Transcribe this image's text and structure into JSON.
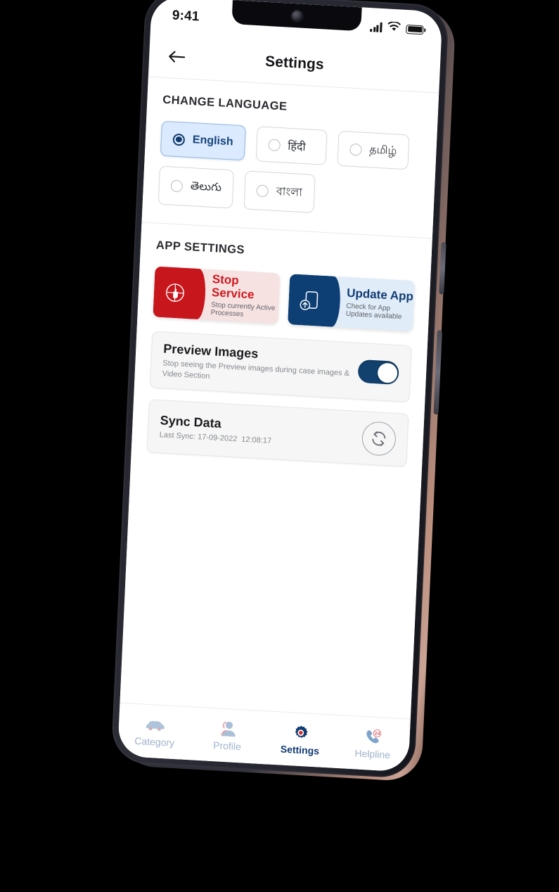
{
  "status_bar": {
    "time": "9:41",
    "signal_icon": "signal-bars-icon",
    "wifi_icon": "wifi-icon",
    "battery_icon": "battery-full-icon"
  },
  "app_bar": {
    "back_icon": "arrow-left-icon",
    "title": "Settings"
  },
  "sections": {
    "language": {
      "title": "CHANGE LANGUAGE",
      "options": [
        {
          "label": "English",
          "selected": true
        },
        {
          "label": "हिंदी",
          "selected": false
        },
        {
          "label": "தமிழ்",
          "selected": false
        },
        {
          "label": "తెలుగు",
          "selected": false
        },
        {
          "label": "বাংলা",
          "selected": false
        }
      ]
    },
    "app_settings": {
      "title": "APP SETTINGS",
      "actions": [
        {
          "title": "Stop Service",
          "subtitle": "Stop currently Active Processes",
          "icon": "stop-hand-icon",
          "accent": "#c8161d",
          "background": "#f7e2e2"
        },
        {
          "title": "Update App",
          "subtitle": "Check for App Updates available",
          "icon": "phone-update-icon",
          "accent": "#0e3f74",
          "background": "#e0ecf7"
        }
      ],
      "preview_images": {
        "title": "Preview Images",
        "subtitle": "Stop seeing the Preview images during case images & Video Section",
        "toggle_on": true,
        "toggle_color": "#12416f"
      },
      "sync_data": {
        "title": "Sync Data",
        "subtitle_label": "Last Sync: 17-09-2022",
        "subtitle_time": "12:08:17",
        "icon": "sync-refresh-icon"
      }
    }
  },
  "bottom_nav": [
    {
      "label": "Category",
      "icon": "car-icon",
      "active": false
    },
    {
      "label": "Profile",
      "icon": "user-icon",
      "active": false
    },
    {
      "label": "Settings",
      "icon": "gear-icon",
      "active": true
    },
    {
      "label": "Helpline",
      "icon": "phone-24h-icon",
      "active": false
    }
  ]
}
